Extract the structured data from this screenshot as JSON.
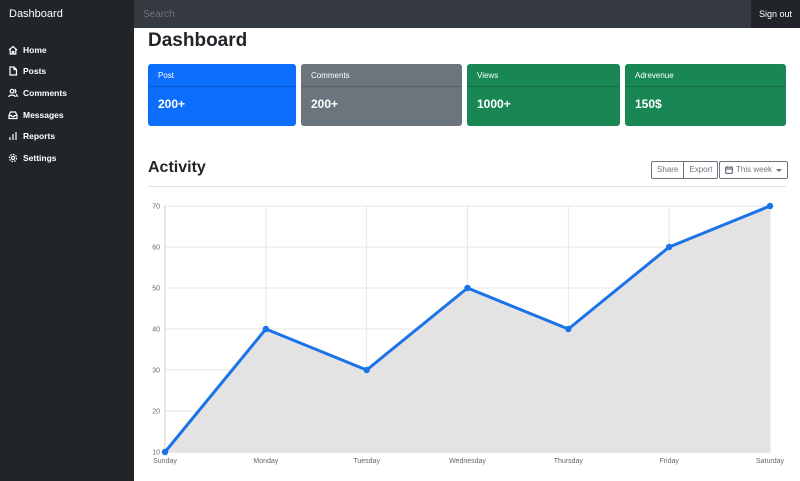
{
  "navbar": {
    "brand": "Dashboard",
    "search_placeholder": "Search",
    "signout_label": "Sign out"
  },
  "sidebar": {
    "items": [
      {
        "label": "Home",
        "icon": "home-icon"
      },
      {
        "label": "Posts",
        "icon": "file-icon"
      },
      {
        "label": "Comments",
        "icon": "users-icon"
      },
      {
        "label": "Messages",
        "icon": "inbox-icon"
      },
      {
        "label": "Reports",
        "icon": "bar-chart-icon"
      },
      {
        "label": "Settings",
        "icon": "gear-icon"
      }
    ]
  },
  "main": {
    "title": "Dashboard",
    "cards": [
      {
        "label": "Post",
        "value": "200+",
        "color": "#0d6efd"
      },
      {
        "label": "Comments",
        "value": "200+",
        "color": "#6c757d"
      },
      {
        "label": "Views",
        "value": "1000+",
        "color": "#198754"
      },
      {
        "label": "Adrevenue",
        "value": "150$",
        "color": "#198754"
      }
    ],
    "activity_title": "Activity",
    "share_label": "Share",
    "export_label": "Export",
    "range_label": "This week"
  },
  "chart_data": {
    "type": "area",
    "categories": [
      "Sunday",
      "Monday",
      "Tuesday",
      "Wednesday",
      "Thursday",
      "Friday",
      "Saturday"
    ],
    "series": [
      {
        "values": [
          10,
          40,
          30,
          50,
          40,
          60,
          70
        ],
        "line_color": "#1a73e8",
        "fill_color": "#e3e3e3"
      }
    ],
    "yticks": [
      10,
      20,
      30,
      40,
      50,
      60,
      70
    ],
    "ylim": [
      10,
      70
    ],
    "grid": true
  }
}
